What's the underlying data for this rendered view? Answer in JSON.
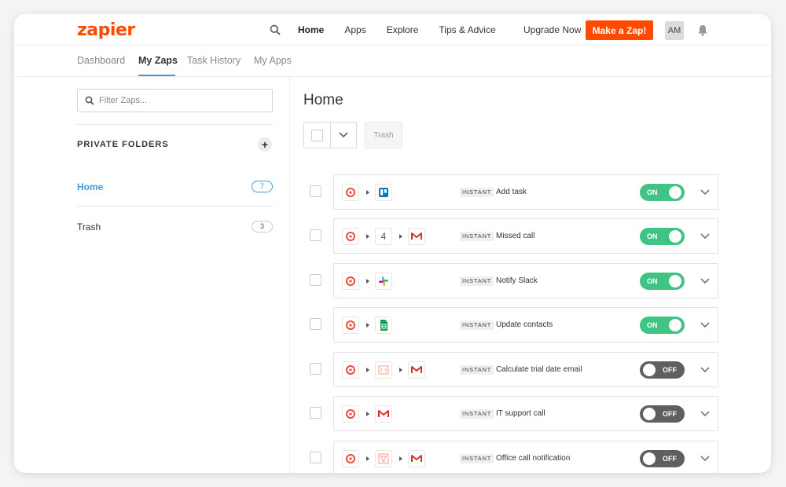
{
  "header": {
    "logo": "zapier",
    "nav": [
      "Home",
      "Apps",
      "Explore",
      "Tips & Advice"
    ],
    "active_nav": "Home",
    "upgrade_label": "Upgrade Now",
    "cta_label": "Make a Zap!",
    "avatar_initials": "AM",
    "accent_color": "#ff4a00"
  },
  "subnav": {
    "tabs": [
      "Dashboard",
      "My Zaps",
      "Task History",
      "My Apps"
    ],
    "active_tab": "My Zaps"
  },
  "sidebar": {
    "filter_placeholder": "Filter Zaps...",
    "folders_title": "PRIVATE FOLDERS",
    "folders": [
      {
        "label": "Home",
        "count": "7",
        "active": true
      },
      {
        "label": "Trash",
        "count": "3",
        "active": false
      }
    ]
  },
  "main": {
    "title": "Home",
    "trash_label": "Trash",
    "zaps": [
      {
        "badge": "INSTANT",
        "name": "Add task",
        "status": "ON",
        "apps": [
          "zapier-trigger-icon",
          "trello-icon"
        ]
      },
      {
        "badge": "INSTANT",
        "name": "Missed call",
        "status": "ON",
        "apps": [
          "zapier-trigger-icon",
          "step-four-icon",
          "gmail-icon"
        ],
        "step_label": "4"
      },
      {
        "badge": "INSTANT",
        "name": "Notify Slack",
        "status": "ON",
        "apps": [
          "zapier-trigger-icon",
          "slack-icon"
        ]
      },
      {
        "badge": "INSTANT",
        "name": "Update contacts",
        "status": "ON",
        "apps": [
          "zapier-trigger-icon",
          "google-sheets-icon"
        ]
      },
      {
        "badge": "INSTANT",
        "name": "Calculate trial date email",
        "status": "OFF",
        "apps": [
          "zapier-trigger-icon",
          "code-icon",
          "gmail-icon"
        ]
      },
      {
        "badge": "INSTANT",
        "name": "IT support call",
        "status": "OFF",
        "apps": [
          "zapier-trigger-icon",
          "gmail-icon"
        ]
      },
      {
        "badge": "INSTANT",
        "name": "Office call notification",
        "status": "OFF",
        "apps": [
          "zapier-trigger-icon",
          "filter-icon",
          "gmail-icon"
        ]
      }
    ]
  },
  "colors": {
    "on": "#3fc484",
    "off": "#5f5f5f",
    "link": "#3d9be0"
  }
}
